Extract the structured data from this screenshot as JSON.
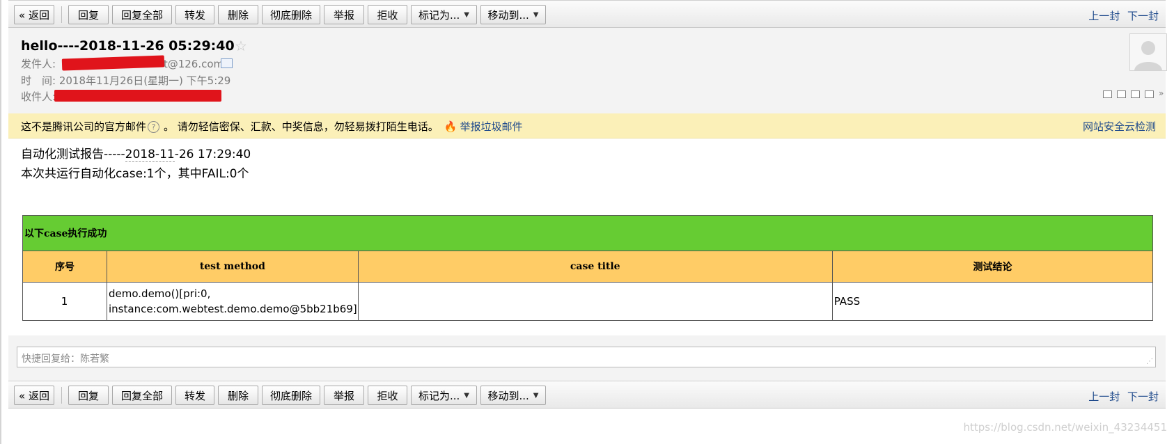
{
  "toolbar": {
    "back": "« 返回",
    "reply": "回复",
    "reply_all": "回复全部",
    "forward": "转发",
    "delete": "删除",
    "delete_permanent": "彻底删除",
    "report": "举报",
    "reject": "拒收",
    "mark_as": "标记为...",
    "move_to": "移动到...",
    "prev": "上一封",
    "next": "下一封"
  },
  "header": {
    "subject": "hello----2018-11-26 05:29:40",
    "sender_label": "发件人:",
    "sender_visible": "t@126.com>",
    "time_label": "时　间:",
    "time_value": "2018年11月26日(星期一) 下午5:29",
    "recipient_label": "收件人:"
  },
  "warning": {
    "text1": "这不是腾讯公司的官方邮件",
    "text2": "。 请勿轻信密保、汇款、中奖信息，勿轻易拨打陌生电话。",
    "report_spam": "举报垃圾邮件",
    "cloud_check": "网站安全云检测"
  },
  "body": {
    "line1_prefix": "自动化测试报告-----",
    "line1_date": "2018-11",
    "line1_suffix": "-26 17:29:40",
    "line2": "本次共运行自动化case:1个，其中FAIL:0个",
    "table": {
      "title": "以下case执行成功",
      "headers": [
        "序号",
        "test method",
        "case title",
        "测试结论"
      ],
      "rows": [
        {
          "index": "1",
          "method_line1": "demo.demo()[pri:0,",
          "method_line2": "instance:com.webtest.demo.demo@5bb21b69]",
          "case_title": "",
          "result": "PASS"
        }
      ]
    }
  },
  "quick_reply": {
    "placeholder": "快捷回复给：陈若繁"
  },
  "watermark": "https://blog.csdn.net/weixin_43234451",
  "colors": {
    "table_title_bg": "#66cc33",
    "table_header_bg": "#ffcc66",
    "warning_bg": "#fbf0b8",
    "link": "#1f4a8c",
    "redaction": "#e0141b"
  }
}
